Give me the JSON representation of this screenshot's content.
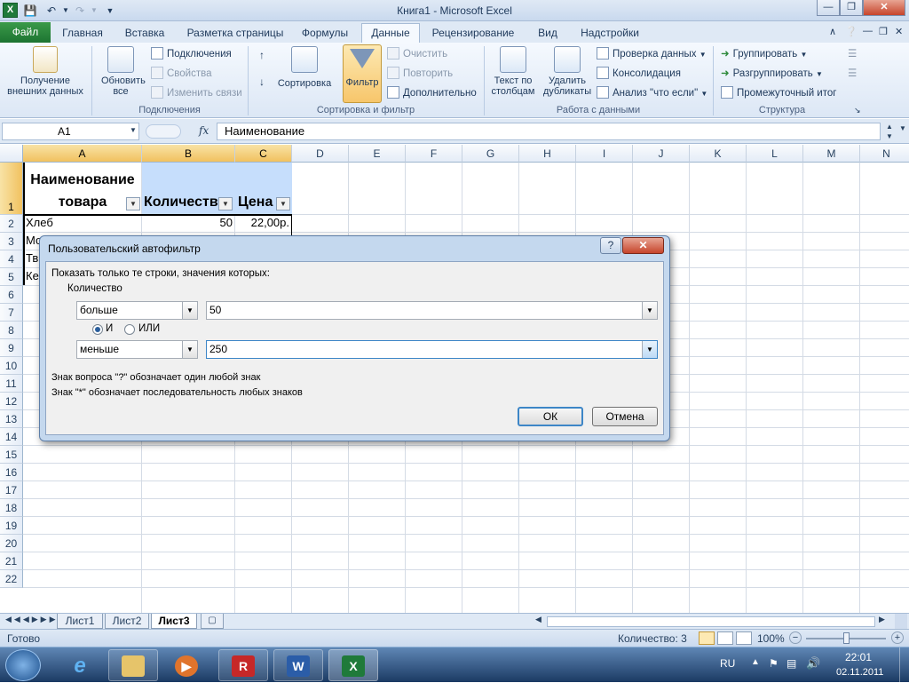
{
  "window": {
    "title": "Книга1  -  Microsoft Excel",
    "app_icon": "X"
  },
  "ribbon_tabs": {
    "file": "Файл",
    "tabs": [
      "Главная",
      "Вставка",
      "Разметка страницы",
      "Формулы",
      "Данные",
      "Рецензирование",
      "Вид",
      "Надстройки"
    ],
    "active": "Данные"
  },
  "ribbon": {
    "external_data": "Получение внешних данных",
    "refresh_all": "Обновить все",
    "connections": {
      "connections": "Подключения",
      "properties": "Свойства",
      "edit_links": "Изменить связи",
      "group": "Подключения"
    },
    "sort_filter": {
      "sort": "Сортировка",
      "filter": "Фильтр",
      "clear": "Очистить",
      "reapply": "Повторить",
      "advanced": "Дополнительно",
      "group": "Сортировка и фильтр"
    },
    "data_tools": {
      "text_to_columns": "Текст по столбцам",
      "remove_duplicates": "Удалить дубликаты",
      "validation": "Проверка данных",
      "consolidate": "Консолидация",
      "what_if": "Анализ \"что если\"",
      "group": "Работа с данными"
    },
    "outline": {
      "group_btn": "Группировать",
      "ungroup": "Разгруппировать",
      "subtotal": "Промежуточный итог",
      "group": "Структура"
    }
  },
  "formula_bar": {
    "name_box": "A1",
    "fx": "fx",
    "value": "Наименование"
  },
  "sheet": {
    "columns": [
      "A",
      "B",
      "C",
      "D",
      "E",
      "F",
      "G",
      "H",
      "I",
      "J",
      "K",
      "L",
      "M",
      "N"
    ],
    "rows": [
      "1",
      "2",
      "3",
      "4",
      "5",
      "6",
      "7",
      "8",
      "9",
      "10",
      "11",
      "12",
      "13",
      "14",
      "15",
      "16",
      "17",
      "18",
      "19",
      "20",
      "21",
      "22"
    ],
    "header": {
      "a_line1": "Наименование",
      "a_line2": "товара",
      "b": "Количеств",
      "c": "Цена"
    },
    "data_rows": [
      {
        "a": "Хлеб",
        "b": "50",
        "c": "22,00р."
      },
      {
        "a": "Мо",
        "b": "",
        "c": ""
      },
      {
        "a": "Тв",
        "b": "",
        "c": ""
      },
      {
        "a": "Ке",
        "b": "",
        "c": ""
      }
    ]
  },
  "sheet_tabs": [
    "Лист1",
    "Лист2",
    "Лист3"
  ],
  "active_sheet": "Лист3",
  "status": {
    "ready": "Готово",
    "count": "Количество: 3",
    "zoom": "100%"
  },
  "taskbar": {
    "lang": "RU",
    "time": "22:01",
    "date": "02.11.2011"
  },
  "dialog": {
    "title": "Пользовательский автофильтр",
    "instruction": "Показать только те строки, значения которых:",
    "field": "Количество",
    "op1": "больше",
    "val1": "50",
    "and_label": "И",
    "or_label": "ИЛИ",
    "logic_selected": "И",
    "op2": "меньше",
    "val2": "250",
    "hint1": "Знак вопроса \"?\" обозначает один любой знак",
    "hint2": "Знак \"*\" обозначает последовательность любых знаков",
    "ok": "ОК",
    "cancel": "Отмена"
  },
  "colors": {
    "accent": "#1d7431",
    "selection": "#f1c15f",
    "header_fill": "#c6defc"
  }
}
